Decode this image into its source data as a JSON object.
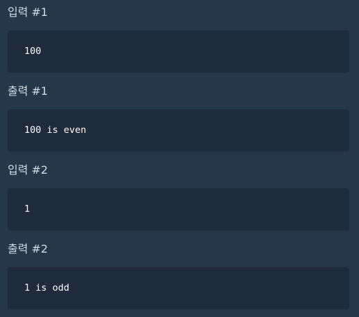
{
  "examples": [
    {
      "heading": "입력 #1",
      "content": "100"
    },
    {
      "heading": "출력 #1",
      "content": "100 is even"
    },
    {
      "heading": "입력 #2",
      "content": "1"
    },
    {
      "heading": "출력 #2",
      "content": "1 is odd"
    }
  ]
}
